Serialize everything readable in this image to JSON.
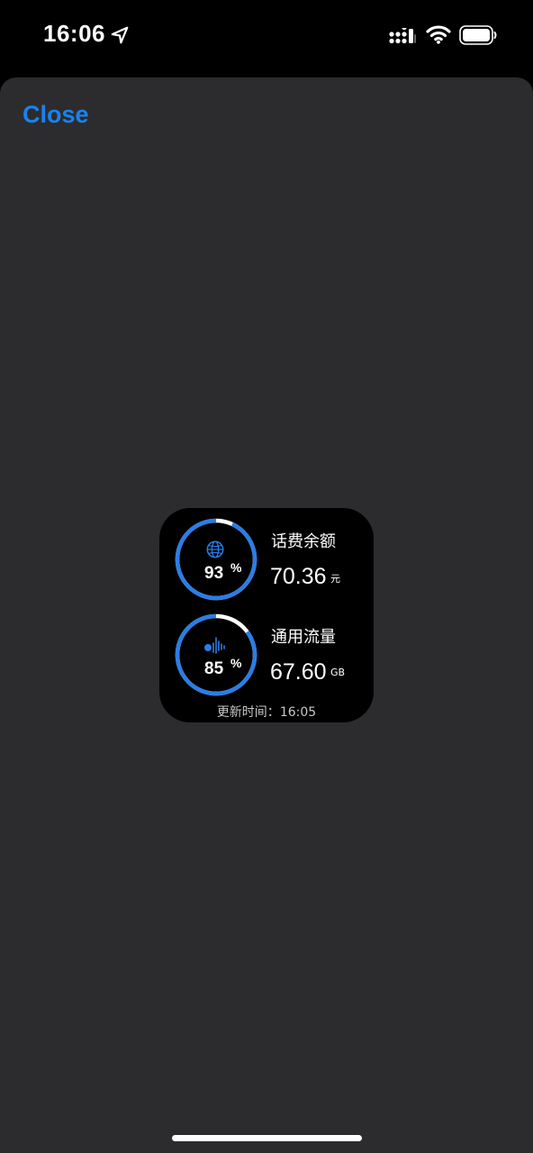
{
  "status_bar": {
    "time": "16:06",
    "icons": [
      "location-arrow-icon",
      "cellular-signal-icon",
      "wifi-icon",
      "battery-icon"
    ]
  },
  "sheet": {
    "close_label": "Close"
  },
  "widget": {
    "items": [
      {
        "icon": "globe-icon",
        "percent": "93",
        "percent_unit": "%",
        "progress": 0.93,
        "label": "话费余额",
        "value": "70.36",
        "unit": "元"
      },
      {
        "icon": "audio-wave-icon",
        "percent": "85",
        "percent_unit": "%",
        "progress": 0.85,
        "label": "通用流量",
        "value": "67.60",
        "unit": "GB"
      }
    ],
    "update_label": "更新时间：",
    "update_time": "16:05"
  },
  "colors": {
    "accent": "#1a82f0",
    "ring": "#2a7de6",
    "sheet_background": "#2c2c2e",
    "widget_background": "#000000"
  }
}
